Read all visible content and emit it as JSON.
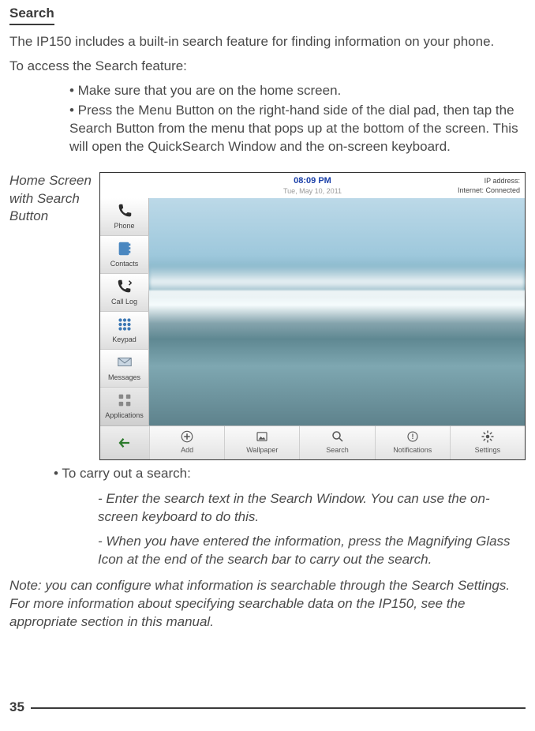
{
  "section_title": "Search",
  "intro1": "The IP150 includes a built-in search feature for finding information on your phone.",
  "intro2": "To access the Search feature:",
  "bullets": {
    "b1": "• Make sure that you are on the home screen.",
    "b2": "• Press the Menu Button on the right-hand side of the dial pad, then tap the Search Button from the menu that pops up at the bottom of the screen. This will open the QuickSearch Window and the on-screen keyboard."
  },
  "figure_caption": "Home Screen with Search Button",
  "screen": {
    "status": {
      "time": "08:09 PM",
      "date": "Tue, May 10, 2011",
      "ip_label": "IP address:",
      "net_label": "Internet: Connected"
    },
    "sidebar": {
      "items": [
        {
          "label": "Phone"
        },
        {
          "label": "Contacts"
        },
        {
          "label": "Call Log"
        },
        {
          "label": "Keypad"
        },
        {
          "label": "Messages"
        },
        {
          "label": "Applications"
        }
      ]
    },
    "bottom": {
      "items": [
        {
          "label": "Add"
        },
        {
          "label": "Wallpaper"
        },
        {
          "label": "Search"
        },
        {
          "label": "Notifications"
        },
        {
          "label": "Settings"
        }
      ]
    }
  },
  "after_fig": {
    "b3": "• To carry out a search:",
    "sb1": "- Enter the search text in the Search Window. You can use the on-screen keyboard to do this.",
    "sb2": "- When you have entered the information, press the Magnifying Glass Icon at the end of the search bar to carry out the search."
  },
  "note": "Note: you can configure what information is searchable through the Search Settings. For more information about specifying searchable data on the IP150, see the appropriate section in this manual.",
  "page_number": "35"
}
